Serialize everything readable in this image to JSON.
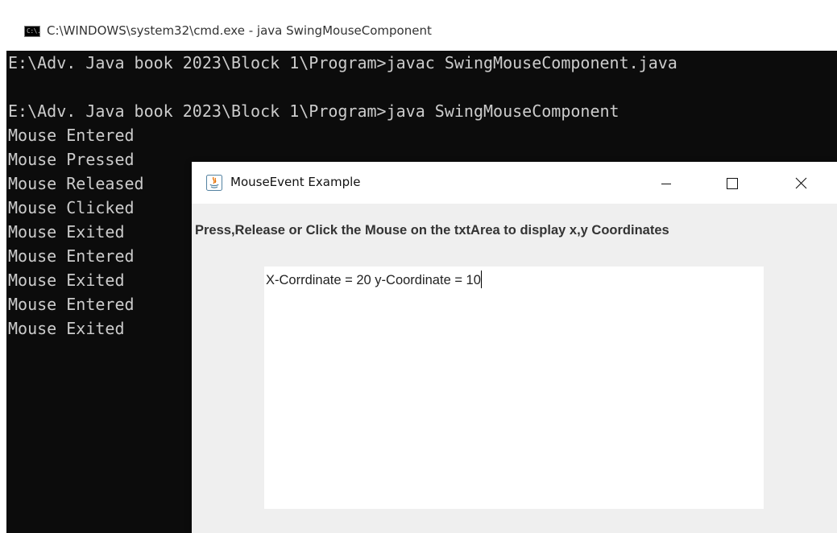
{
  "cmd": {
    "title": "C:\\WINDOWS\\system32\\cmd.exe - java  SwingMouseComponent",
    "icon": "cmd-icon",
    "icon_glyph": "C:\\.",
    "lines": [
      "E:\\Adv. Java book 2023\\Block 1\\Program>javac SwingMouseComponent.java",
      "",
      "E:\\Adv. Java book 2023\\Block 1\\Program>java SwingMouseComponent",
      "Mouse Entered",
      "Mouse Pressed",
      "Mouse Released",
      "Mouse Clicked",
      "Mouse Exited",
      "Mouse Entered",
      "Mouse Exited",
      "Mouse Entered",
      "Mouse Exited"
    ]
  },
  "swing": {
    "title": "MouseEvent Example",
    "icon": "java-icon",
    "controls": [
      "minimize-icon",
      "maximize-icon",
      "close-icon"
    ],
    "label": "Press,Release or Click the Mouse on the txtArea to display x,y Coordinates",
    "textarea_value": "X-Corrdinate = 20 y-Coordinate = 10"
  },
  "colors": {
    "console_bg": "#0c0c0c",
    "console_text": "#cccccc",
    "swing_bg": "#f0f0f0",
    "java_icon_orange": "#e76f00",
    "java_icon_blue": "#5382a1"
  }
}
